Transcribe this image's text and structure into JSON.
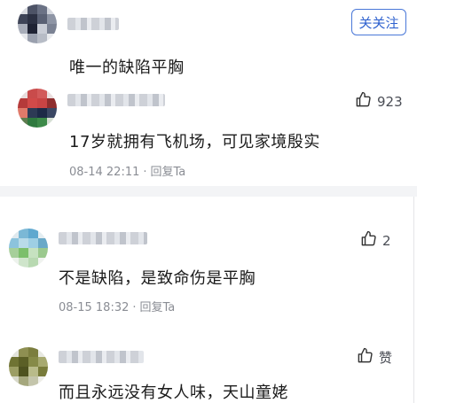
{
  "header": {
    "follow_label": "关关注"
  },
  "comments": [
    {
      "text": "唯一的缺陷平胸"
    },
    {
      "text": "17岁就拥有飞机场，可见家境殷实",
      "meta": {
        "date": "08-14 22:11",
        "reply": "回复Ta"
      },
      "likes": "923"
    },
    {
      "text": "不是缺陷，是致命伤是平胸",
      "meta": {
        "date": "08-15 18:32",
        "reply": "回复Ta"
      },
      "likes": "2"
    },
    {
      "text": "而且永远没有女人味，天山童姥",
      "likes": "赞"
    }
  ],
  "colors": {
    "accent": "#2f62cf",
    "meta": "#8a8d94",
    "divider": "#f3f4f6"
  }
}
